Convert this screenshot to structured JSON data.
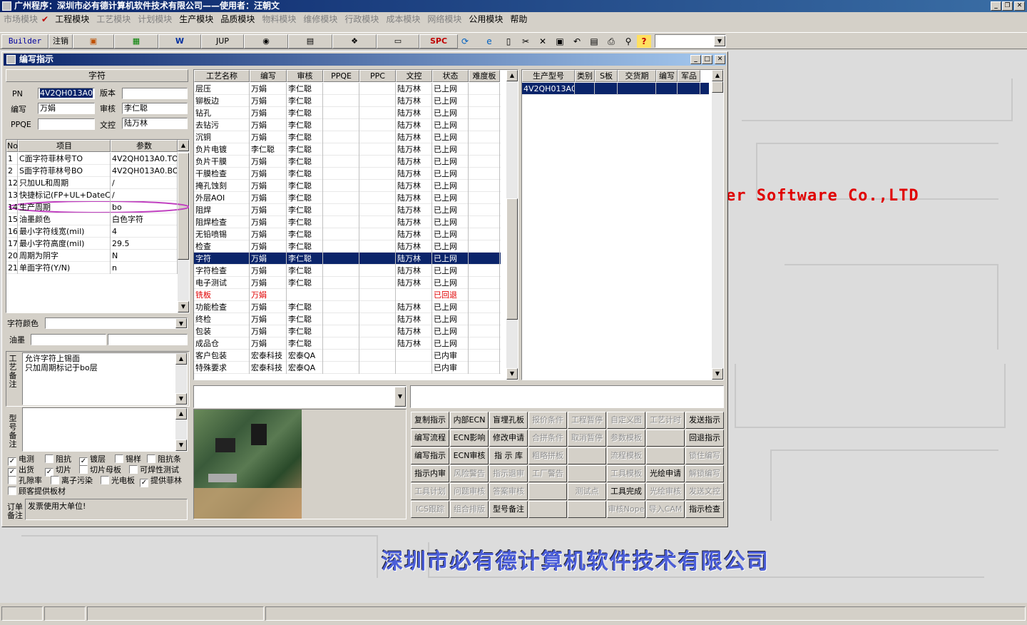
{
  "app": {
    "title": "广州程序：深圳市必有德计算机软件技术有限公司——使用者：汪朝文"
  },
  "menu": [
    {
      "label": "市场模块",
      "enabled": false
    },
    {
      "label": "工程模块",
      "enabled": true,
      "checked": true
    },
    {
      "label": "工艺模块",
      "enabled": false
    },
    {
      "label": "计划模块",
      "enabled": false
    },
    {
      "label": "生产模块",
      "enabled": true
    },
    {
      "label": "品质模块",
      "enabled": true
    },
    {
      "label": "物料模块",
      "enabled": false
    },
    {
      "label": "维修模块",
      "enabled": false
    },
    {
      "label": "行政模块",
      "enabled": false
    },
    {
      "label": "成本模块",
      "enabled": false
    },
    {
      "label": "网络模块",
      "enabled": false
    },
    {
      "label": "公用模块",
      "enabled": true
    },
    {
      "label": "帮助",
      "enabled": true
    }
  ],
  "toolbar": {
    "builder": "Builder",
    "logout": "注销",
    "jup": "JUP",
    "spc": "SPC",
    "word": "W"
  },
  "window": {
    "title": "编写指示"
  },
  "charsec": {
    "header": "字符",
    "pn_label": "PN",
    "pn": "4V2QH013A0",
    "version_label": "版本",
    "version": "",
    "author_label": "编写",
    "author": "万娟",
    "reviewer_label": "审核",
    "reviewer": "李仁聪",
    "ppqe_label": "PPQE",
    "ppqe": "",
    "doc_label": "文控",
    "doc": "陆万林"
  },
  "params": {
    "headers": [
      "No",
      "项目",
      "参数"
    ],
    "rows": [
      {
        "no": "1",
        "item": "C面字符菲林号TO",
        "value": "4V2QH013A0.TO"
      },
      {
        "no": "2",
        "item": "S面字符菲林号BO",
        "value": "4V2QH013A0.BO"
      },
      {
        "no": "12",
        "item": "只加UL和周期",
        "value": "/"
      },
      {
        "no": "13",
        "item": "快捷标记(FP+UL+DateCo",
        "value": "/"
      },
      {
        "no": "14",
        "item": "生产周期",
        "value": "bo"
      },
      {
        "no": "15",
        "item": "油墨颜色",
        "value": "白色字符"
      },
      {
        "no": "16",
        "item": "最小字符线宽(mil)",
        "value": "4"
      },
      {
        "no": "17",
        "item": "最小字符高度(mil)",
        "value": "29.5"
      },
      {
        "no": "20",
        "item": "周期为阴字",
        "value": "N"
      },
      {
        "no": "21",
        "item": "单面字符(Y/N)",
        "value": "n"
      }
    ]
  },
  "charcolor_label": "字符颜色",
  "ink_label": "油墨",
  "process_note": {
    "label": "工艺备注",
    "lines": [
      "允许字符上锡面",
      "只加周期标记于bo层"
    ]
  },
  "model_note": {
    "label": "型号备注"
  },
  "checkboxes": [
    {
      "label": "电测",
      "checked": true
    },
    {
      "label": "阻抗",
      "checked": false
    },
    {
      "label": "镀层",
      "checked": true
    },
    {
      "label": "锡样",
      "checked": false
    },
    {
      "label": "阻抗条",
      "checked": false
    },
    {
      "label": "出货",
      "checked": true
    },
    {
      "label": "切片",
      "checked": true
    },
    {
      "label": "切片母板",
      "checked": false
    },
    {
      "label": "可焊性测试",
      "checked": false
    },
    {
      "label": "孔隙率",
      "checked": false
    },
    {
      "label": "离子污染",
      "checked": false
    },
    {
      "label": "光电板",
      "checked": false
    },
    {
      "label": "提供菲林",
      "checked": true
    },
    {
      "label": "顾客提供板材",
      "checked": false
    }
  ],
  "order_note": {
    "label": "订单备注",
    "text": "发票使用大单位!"
  },
  "process": {
    "headers": [
      "工艺名称",
      "编写",
      "审核",
      "PPQE",
      "PPC",
      "文控",
      "状态",
      "难度板"
    ],
    "selected_index": 14,
    "rows": [
      [
        "层压",
        "万娟",
        "李仁聪",
        "",
        "",
        "陆万林",
        "已上网",
        ""
      ],
      [
        "铆板边",
        "万娟",
        "李仁聪",
        "",
        "",
        "陆万林",
        "已上网",
        ""
      ],
      [
        "钻孔",
        "万娟",
        "李仁聪",
        "",
        "",
        "陆万林",
        "已上网",
        ""
      ],
      [
        "去钻污",
        "万娟",
        "李仁聪",
        "",
        "",
        "陆万林",
        "已上网",
        ""
      ],
      [
        "沉铜",
        "万娟",
        "李仁聪",
        "",
        "",
        "陆万林",
        "已上网",
        ""
      ],
      [
        "负片电镀",
        "李仁聪",
        "李仁聪",
        "",
        "",
        "陆万林",
        "已上网",
        ""
      ],
      [
        "负片干膜",
        "万娟",
        "李仁聪",
        "",
        "",
        "陆万林",
        "已上网",
        ""
      ],
      [
        "干膜检查",
        "万娟",
        "李仁聪",
        "",
        "",
        "陆万林",
        "已上网",
        ""
      ],
      [
        "掩孔蚀刻",
        "万娟",
        "李仁聪",
        "",
        "",
        "陆万林",
        "已上网",
        ""
      ],
      [
        "外层AOI",
        "万娟",
        "李仁聪",
        "",
        "",
        "陆万林",
        "已上网",
        ""
      ],
      [
        "阻焊",
        "万娟",
        "李仁聪",
        "",
        "",
        "陆万林",
        "已上网",
        ""
      ],
      [
        "阻焊检查",
        "万娟",
        "李仁聪",
        "",
        "",
        "陆万林",
        "已上网",
        ""
      ],
      [
        "无铅喷锡",
        "万娟",
        "李仁聪",
        "",
        "",
        "陆万林",
        "已上网",
        ""
      ],
      [
        "检查",
        "万娟",
        "李仁聪",
        "",
        "",
        "陆万林",
        "已上网",
        ""
      ],
      [
        "字符",
        "万娟",
        "李仁聪",
        "",
        "",
        "陆万林",
        "已上网",
        ""
      ],
      [
        "字符检查",
        "万娟",
        "李仁聪",
        "",
        "",
        "陆万林",
        "已上网",
        ""
      ],
      [
        "电子测试",
        "万娟",
        "李仁聪",
        "",
        "",
        "陆万林",
        "已上网",
        ""
      ],
      [
        "铣板",
        "万娟",
        "",
        "",
        "",
        "",
        "已回退",
        ""
      ],
      [
        "功能检查",
        "万娟",
        "李仁聪",
        "",
        "",
        "陆万林",
        "已上网",
        ""
      ],
      [
        "终检",
        "万娟",
        "李仁聪",
        "",
        "",
        "陆万林",
        "已上网",
        ""
      ],
      [
        "包装",
        "万娟",
        "李仁聪",
        "",
        "",
        "陆万林",
        "已上网",
        ""
      ],
      [
        "成品仓",
        "万娟",
        "李仁聪",
        "",
        "",
        "陆万林",
        "已上网",
        ""
      ],
      [
        "客户包装",
        "宏泰科技",
        "宏泰QA",
        "",
        "",
        "",
        "已内审",
        ""
      ],
      [
        "特殊要求",
        "宏泰科技",
        "宏泰QA",
        "",
        "",
        "",
        "已内审",
        ""
      ]
    ]
  },
  "models": {
    "headers": [
      "生产型号",
      "类别",
      "S板",
      "交货期",
      "编写",
      "军品"
    ],
    "rows": [
      [
        "4V2QH013A0",
        "",
        "",
        "",
        "",
        ""
      ]
    ]
  },
  "buttons": [
    {
      "label": "复制指示",
      "enabled": true
    },
    {
      "label": "内部ECN",
      "enabled": true
    },
    {
      "label": "盲埋孔板",
      "enabled": true
    },
    {
      "label": "报价条件",
      "enabled": false
    },
    {
      "label": "工程暂停",
      "enabled": false
    },
    {
      "label": "自定义图",
      "enabled": false
    },
    {
      "label": "工艺计时",
      "enabled": false
    },
    {
      "label": "发送指示",
      "enabled": true
    },
    {
      "label": "编写流程",
      "enabled": true
    },
    {
      "label": "ECN影响",
      "enabled": true
    },
    {
      "label": "修改申请",
      "enabled": true
    },
    {
      "label": "合拼条件",
      "enabled": false
    },
    {
      "label": "取消暂停",
      "enabled": false
    },
    {
      "label": "参数模板",
      "enabled": false
    },
    {
      "label": "",
      "enabled": false
    },
    {
      "label": "回退指示",
      "enabled": true
    },
    {
      "label": "编写指示",
      "enabled": true
    },
    {
      "label": "ECN审核",
      "enabled": true
    },
    {
      "label": "指 示 库",
      "enabled": true
    },
    {
      "label": "粗略拼板",
      "enabled": false
    },
    {
      "label": "",
      "enabled": false
    },
    {
      "label": "流程模板",
      "enabled": false
    },
    {
      "label": "",
      "enabled": false
    },
    {
      "label": "锁住编写",
      "enabled": false
    },
    {
      "label": "指示内审",
      "enabled": true
    },
    {
      "label": "风险警告",
      "enabled": false
    },
    {
      "label": "指示退审",
      "enabled": false
    },
    {
      "label": "工厂警告",
      "enabled": false
    },
    {
      "label": "",
      "enabled": false
    },
    {
      "label": "工具模板",
      "enabled": false
    },
    {
      "label": "光绘申请",
      "enabled": true
    },
    {
      "label": "解锁编写",
      "enabled": false
    },
    {
      "label": "工具计划",
      "enabled": false
    },
    {
      "label": "问题审核",
      "enabled": false
    },
    {
      "label": "答案审核",
      "enabled": false
    },
    {
      "label": "",
      "enabled": false
    },
    {
      "label": "测试点",
      "enabled": false
    },
    {
      "label": "工具完成",
      "enabled": true
    },
    {
      "label": "光绘审核",
      "enabled": false
    },
    {
      "label": "发送文控",
      "enabled": false
    },
    {
      "label": "ICS跟踪",
      "enabled": false
    },
    {
      "label": "组合排版",
      "enabled": false
    },
    {
      "label": "型号备注",
      "enabled": true
    },
    {
      "label": "",
      "enabled": false
    },
    {
      "label": "",
      "enabled": false
    },
    {
      "label": "审核Nope",
      "enabled": false
    },
    {
      "label": "导入CAM",
      "enabled": false
    },
    {
      "label": "指示检查",
      "enabled": true
    }
  ],
  "background": {
    "brand_en": "er Software Co.,LTD",
    "brand_cn": "深圳市必有德计算机软件技术有限公司"
  },
  "colors": {
    "titlebar": "#0a246a",
    "selection": "#0a246a",
    "highlight_ellipse": "#c040c0",
    "brand_red": "#e00000",
    "brand_blue": "#4b5ed8"
  }
}
